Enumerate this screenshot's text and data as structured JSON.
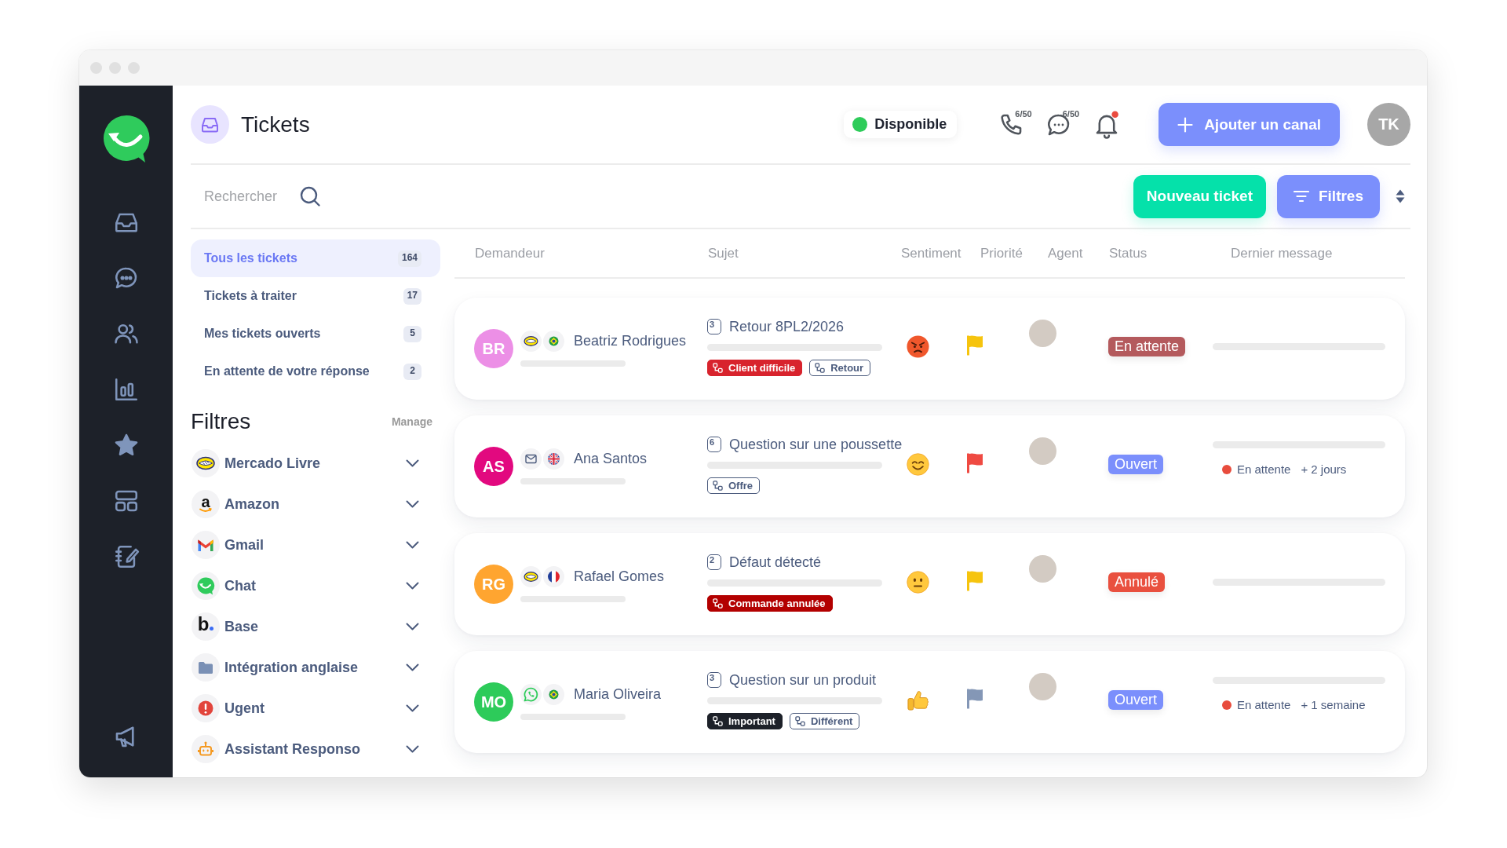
{
  "window": {
    "title": "Tickets"
  },
  "header": {
    "presence": {
      "label": "Disponible",
      "online": true
    },
    "counters": [
      {
        "kind": "calls",
        "value": "6/50"
      },
      {
        "kind": "chats",
        "value": "6/50"
      }
    ],
    "notifications": {
      "unread": true
    },
    "add_channel": {
      "label": "Ajouter un canal"
    },
    "user": {
      "initials": "TK"
    }
  },
  "toolbar": {
    "search": {
      "placeholder": "Rechercher"
    },
    "buttons": [
      {
        "kind": "create",
        "label": "Nouveau ticket"
      },
      {
        "kind": "filter",
        "label": "Filtres"
      }
    ]
  },
  "views": [
    {
      "label": "Tous les tickets",
      "count": "164",
      "selected": true
    },
    {
      "label": "Tickets à traiter",
      "count": "17",
      "selected": false
    },
    {
      "label": "Mes tickets ouverts",
      "count": "5",
      "selected": false
    },
    {
      "label": "En attente de votre réponse",
      "count": "2",
      "selected": false
    }
  ],
  "filters": {
    "title": "Filtres",
    "manage": "Manage",
    "items": [
      {
        "kind": "handshake",
        "label": "Mercado Livre",
        "expanded": false
      },
      {
        "kind": "letter_smile",
        "logo": "a",
        "label": "Amazon",
        "expanded": false
      },
      {
        "kind": "mail",
        "label": "Gmail",
        "expanded": false
      },
      {
        "kind": "chat",
        "label": "Chat",
        "expanded": false
      },
      {
        "kind": "letter_dot",
        "logo": "b",
        "label": "Base",
        "expanded": false
      },
      {
        "kind": "folder",
        "label": "Intégration anglaise",
        "expanded": false
      },
      {
        "kind": "alert",
        "label": "Ugent",
        "expanded": false
      },
      {
        "kind": "bot",
        "label": "Assistant Responso",
        "expanded": false
      }
    ]
  },
  "table": {
    "columns": [
      "Demandeur",
      "Sujet",
      "Sentiment",
      "Priorité",
      "Agent",
      "Status",
      "Dernier message"
    ],
    "rows": [
      {
        "requester": {
          "initials": "BR",
          "name": "Beatriz Rodrigues",
          "color": "#ec8fe6",
          "channel": {
            "kind": "handshake"
          },
          "flag": {
            "kind": "br"
          }
        },
        "subject": {
          "messages": "3",
          "title": "Retour 8PL2/2026",
          "tags": [
            {
              "label": "Client difficile",
              "kind": "filled",
              "color": "#d8232d"
            },
            {
              "label": "Retour",
              "kind": "outline"
            }
          ]
        },
        "sentiment": {
          "kind": "angry"
        },
        "priority": {
          "color": "#f6c40e"
        },
        "status": {
          "label": "En attente",
          "color": "#b45a5d"
        }
      },
      {
        "requester": {
          "initials": "AS",
          "name": "Ana Santos",
          "color": "#e2097f",
          "channel": {
            "kind": "envelope"
          },
          "flag": {
            "kind": "gb"
          }
        },
        "subject": {
          "messages": "6",
          "title": "Question sur une poussette",
          "tags": [
            {
              "label": "Offre",
              "kind": "outline"
            }
          ]
        },
        "sentiment": {
          "kind": "happy"
        },
        "priority": {
          "color": "#ef4a42"
        },
        "status": {
          "label": "Ouvert",
          "color": "#7b8ffc"
        },
        "last_message": {
          "state": "En attente",
          "color": "#e84c3d",
          "age": "+ 2 jours"
        }
      },
      {
        "requester": {
          "initials": "RG",
          "name": "Rafael Gomes",
          "color": "#ffa530",
          "channel": {
            "kind": "handshake"
          },
          "flag": {
            "kind": "fr"
          }
        },
        "subject": {
          "messages": "2",
          "title": "Défaut détecté",
          "tags": [
            {
              "label": "Commande annulée",
              "kind": "filled",
              "color": "#b30000"
            }
          ]
        },
        "sentiment": {
          "kind": "neutral"
        },
        "priority": {
          "color": "#f6c40e"
        },
        "status": {
          "label": "Annulé",
          "color": "#e9503f"
        }
      },
      {
        "requester": {
          "initials": "MO",
          "name": "Maria Oliveira",
          "color": "#2dcb5a",
          "channel": {
            "kind": "phone_bubble"
          },
          "flag": {
            "kind": "br"
          }
        },
        "subject": {
          "messages": "3",
          "title": "Question sur un produit",
          "tags": [
            {
              "label": "Important",
              "kind": "filled",
              "color": "#1d2129"
            },
            {
              "label": "Différent",
              "kind": "outline"
            }
          ]
        },
        "sentiment": {
          "kind": "thumbs_up"
        },
        "priority": {
          "color": "#8497b6"
        },
        "status": {
          "label": "Ouvert",
          "color": "#7b8ffc"
        },
        "last_message": {
          "state": "En attente",
          "color": "#e84c3d",
          "age": "+ 1 semaine"
        }
      }
    ]
  }
}
